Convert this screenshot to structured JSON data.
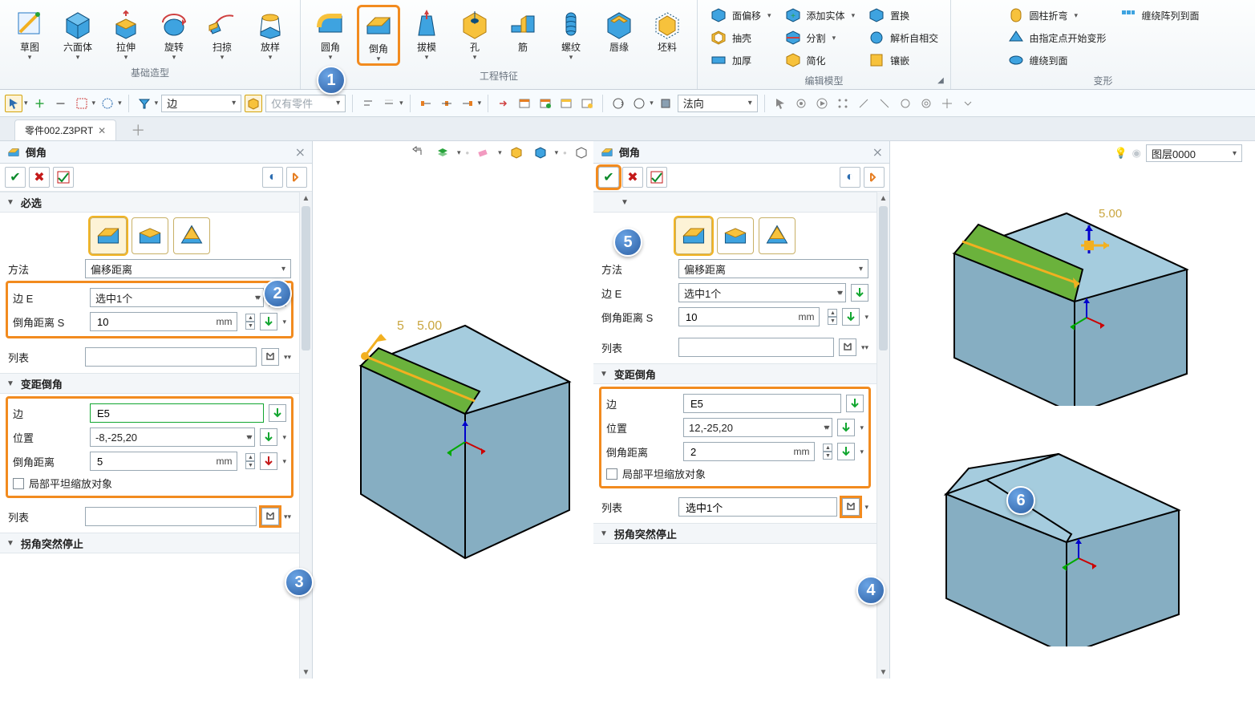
{
  "ribbon": {
    "groups": {
      "base": {
        "label": "基础造型",
        "items": [
          "草图",
          "六面体",
          "拉伸",
          "旋转",
          "扫掠",
          "放样"
        ]
      },
      "feat": {
        "label": "工程特征",
        "items": [
          "圆角",
          "倒角",
          "拔模",
          "孔",
          "筋",
          "螺纹",
          "唇缘",
          "坯料"
        ]
      },
      "edit": {
        "label": "编辑模型",
        "col1": [
          "面偏移",
          "抽壳",
          "加厚"
        ],
        "col2": [
          "添加实体",
          "分割",
          "简化"
        ],
        "col3": [
          "置换",
          "解析自相交",
          "镶嵌"
        ]
      },
      "deform": {
        "label": "变形",
        "col1": [
          "圆柱折弯",
          "由指定点开始变形",
          "缠绕到面"
        ],
        "col2": [
          "缠绕阵列到面"
        ]
      }
    }
  },
  "toolstrip": {
    "filter_combo": "边",
    "scope_combo": "仅有零件",
    "orient_combo": "法向"
  },
  "tab": {
    "name": "零件002.Z3PRT"
  },
  "viewLayer": {
    "label": "图层0000"
  },
  "panel": {
    "title": "倒角",
    "sections": {
      "must": "必选",
      "vari": "变距倒角",
      "stop": "拐角突然停止"
    },
    "labels": {
      "method": "方法",
      "edge": "边 E",
      "dist": "倒角距离 S",
      "list": "列表",
      "edge2": "边",
      "pos": "位置",
      "dist2": "倒角距离",
      "flat": "局部平坦缩放对象",
      "method_value": "偏移距离",
      "edge_value": "选中1个",
      "mm": "mm"
    }
  },
  "left": {
    "dist": "10",
    "edge2_value": "E5",
    "pos": "-8,-25,20",
    "dist2": "5",
    "list_sel": ""
  },
  "right": {
    "dist": "10",
    "edge2_value": "E5",
    "pos": "12,-25,20",
    "dist2": "2",
    "list_sel": "选中1个"
  },
  "preview_dim": "5.00"
}
